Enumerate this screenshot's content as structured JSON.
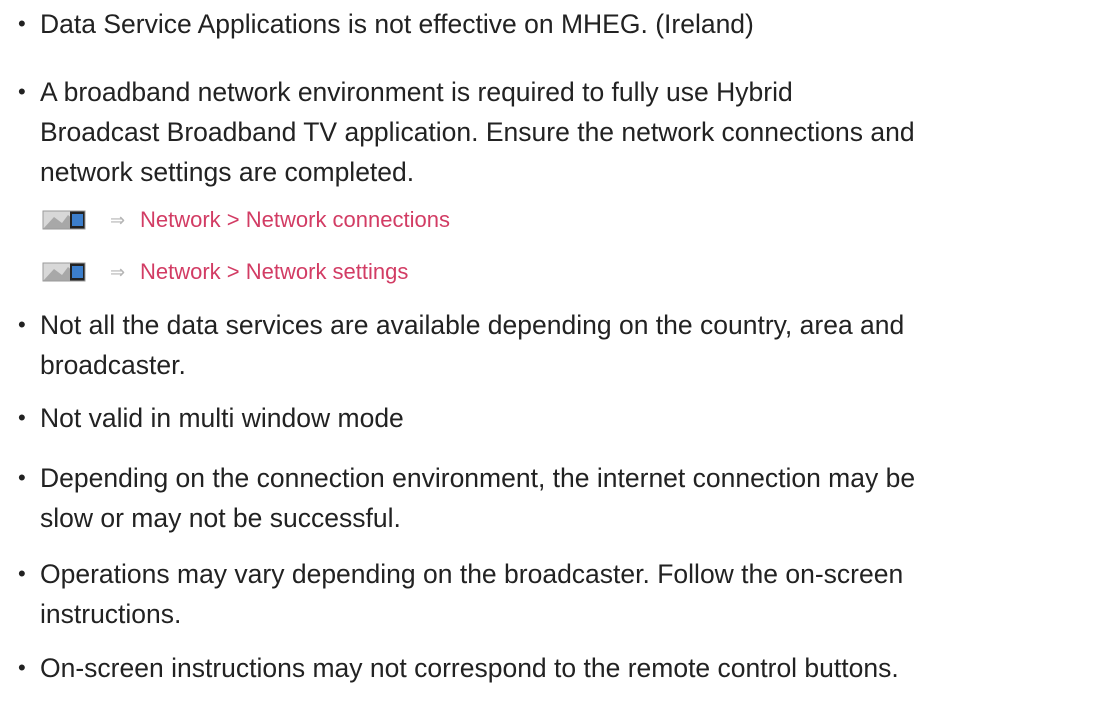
{
  "colors": {
    "text": "#222222",
    "link": "#d23c64",
    "icon": "#9a9a9a",
    "arrow": "#b5b5b5"
  },
  "bullet_symbol": "•",
  "bullets": [
    {
      "lines": [
        "Data Service Applications is not effective on MHEG. (Ireland)"
      ]
    },
    {
      "lines": [
        "A broadband network environment is required to fully use Hybrid",
        "Broadcast Broadband TV application. Ensure the network connections and",
        "network settings are completed."
      ]
    },
    {
      "lines": [
        "Not all the data services are available depending on the country, area and",
        "broadcaster."
      ]
    },
    {
      "lines": [
        "Not valid in multi window mode"
      ]
    },
    {
      "lines": [
        "Depending on the connection environment, the internet connection may be",
        "slow or may not be successful."
      ]
    },
    {
      "lines": [
        "Operations may vary depending on the broadcaster. Follow the on-screen",
        "instructions."
      ]
    },
    {
      "lines": [
        "On-screen instructions may not correspond to the remote control buttons."
      ]
    }
  ],
  "nav_links": [
    {
      "icon": "menu-tv-icon",
      "arrow": "⇒",
      "text": "Network > Network connections"
    },
    {
      "icon": "menu-tv-icon",
      "arrow": "⇒",
      "text": "Network > Network settings"
    }
  ]
}
